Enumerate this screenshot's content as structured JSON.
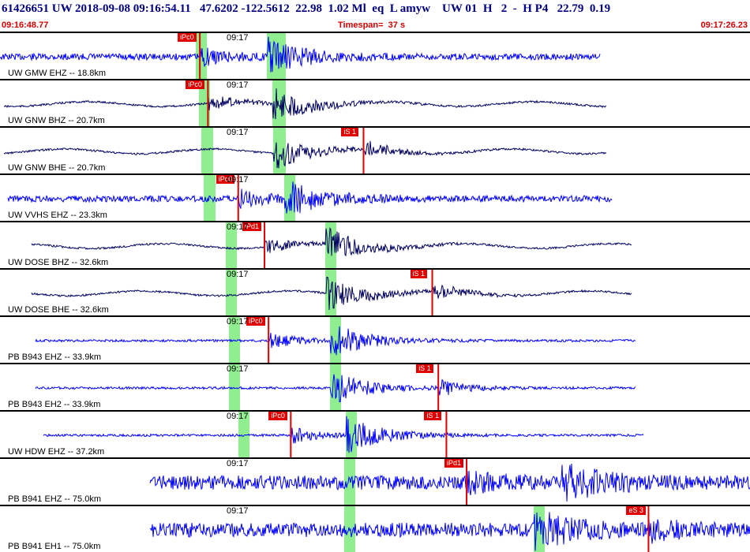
{
  "header": {
    "title": "61426651 UW 2018-09-08 09:16:54.11   47.6202 -122.5612  22.98  1.02 Ml  eq  L amyw    UW 01  H   2  -  H P4   22.79  0.19",
    "start_time": "09:16:48.77",
    "timespan": "Timespan=  37 s",
    "end_time": "09:17:26.23"
  },
  "colors": {
    "trace_blue": "#0000ff",
    "trace_navy": "#000060",
    "pick": "#e00000",
    "window": "#90ee90",
    "title": "#000080"
  },
  "channels": [
    {
      "label": "UW GMW EHZ -- 18.8km",
      "tick": "09:17",
      "picks": [
        {
          "text": "iPc0",
          "t": 0.2
        }
      ],
      "color": "blue"
    },
    {
      "label": "UW GNW BHZ -- 20.7km",
      "tick": "09:17",
      "picks": [
        {
          "text": "iPc0",
          "t": 0.6
        }
      ],
      "color": "navy"
    },
    {
      "label": "UW GNW BHE -- 20.7km",
      "tick": "09:17",
      "picks": [
        {
          "text": "iS 1",
          "t": 8.3
        }
      ],
      "color": "navy"
    },
    {
      "label": "UW VVHS EHZ -- 23.3km",
      "tick": "09:17",
      "picks": [
        {
          "text": "iPc0",
          "t": 2.1
        }
      ],
      "color": "blue"
    },
    {
      "label": "UW DOSE BHZ -- 32.6km",
      "tick": "09:17",
      "picks": [
        {
          "text": "iPd1",
          "t": 3.4
        }
      ],
      "color": "navy"
    },
    {
      "label": "UW DOSE BHE -- 32.6km",
      "tick": "09:17",
      "picks": [
        {
          "text": "iS 1",
          "t": 11.7
        }
      ],
      "color": "navy"
    },
    {
      "label": "PB B943 EHZ -- 33.9km",
      "tick": "09:17",
      "picks": [
        {
          "text": "iPc0",
          "t": 3.6
        }
      ],
      "color": "blue"
    },
    {
      "label": "PB B943 EH2 -- 33.9km",
      "tick": "09:17",
      "picks": [
        {
          "text": "iS 1",
          "t": 12.0
        }
      ],
      "color": "blue"
    },
    {
      "label": "UW HDW EHZ -- 37.2km",
      "tick": "09:17",
      "picks": [
        {
          "text": "iPc0",
          "t": 4.7
        },
        {
          "text": "iS 1",
          "t": 12.4
        }
      ],
      "color": "blue"
    },
    {
      "label": "PB B941 EHZ -- 75.0km",
      "tick": "09:17",
      "picks": [
        {
          "text": "iPd1",
          "t": 13.4
        }
      ],
      "color": "blue"
    },
    {
      "label": "PB B941 EH1 -- 75.0km",
      "tick": "09:17",
      "picks": [
        {
          "text": "eS 3",
          "t": 22.4
        }
      ],
      "color": "blue"
    }
  ]
}
